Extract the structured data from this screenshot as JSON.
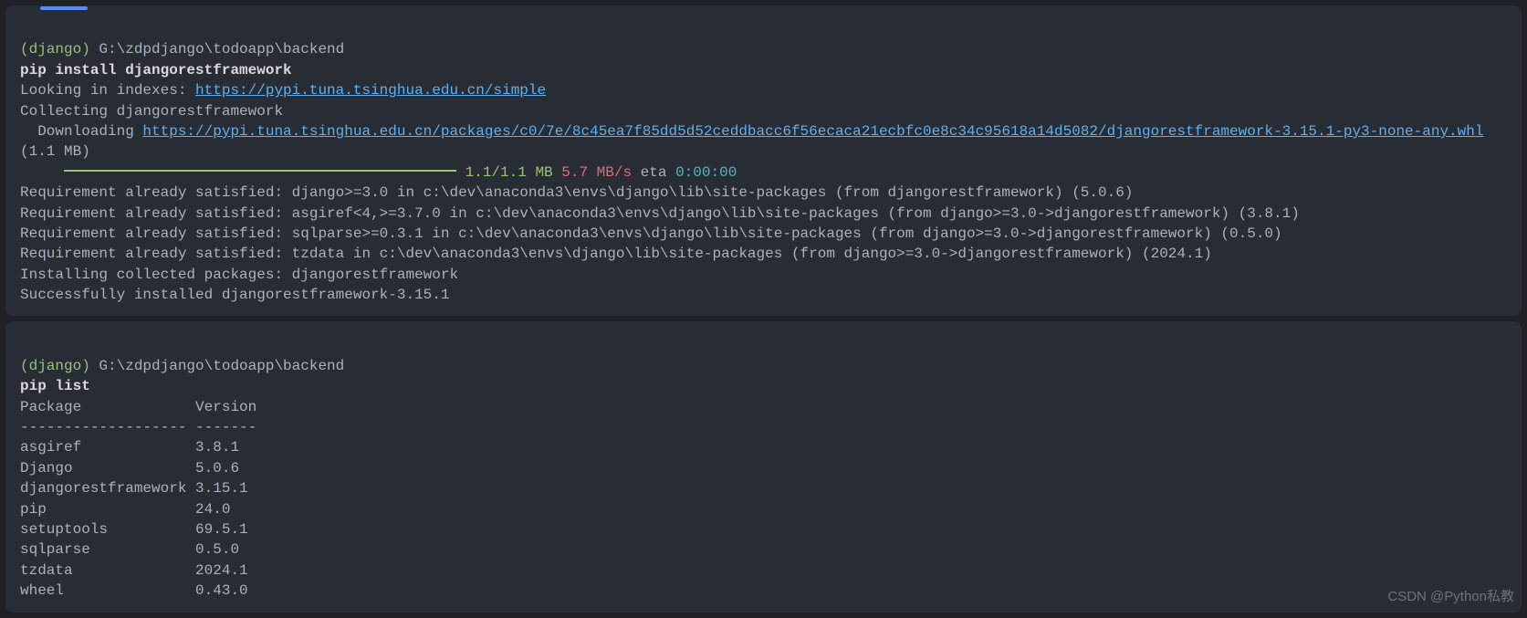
{
  "block1": {
    "prompt": {
      "env": "(django)",
      "path": " G:\\zdpdjango\\todoapp\\backend"
    },
    "command": "pip install djangorestframework",
    "lookingIn": "Looking in indexes: ",
    "indexUrl": "https://pypi.tuna.tsinghua.edu.cn/simple",
    "collecting": "Collecting djangorestframework",
    "downloading": "  Downloading ",
    "downloadUrl": "https://pypi.tuna.tsinghua.edu.cn/packages/c0/7e/8c45ea7f85dd5d52ceddbacc6f56ecaca21ecbfc0e8c34c95618a14d5082/djangorestframework-3.15.1-py3-none-any.whl",
    "downloadSize": " (1.1 MB)",
    "progress": {
      "size": "1.1/1.1 MB",
      "speed": "5.7 MB/s",
      "etaLabel": " eta ",
      "eta": "0:00:00"
    },
    "req1": "Requirement already satisfied: django>=3.0 in c:\\dev\\anaconda3\\envs\\django\\lib\\site-packages (from djangorestframework) (5.0.6)",
    "req2": "Requirement already satisfied: asgiref<4,>=3.7.0 in c:\\dev\\anaconda3\\envs\\django\\lib\\site-packages (from django>=3.0->djangorestframework) (3.8.1)",
    "req3": "Requirement already satisfied: sqlparse>=0.3.1 in c:\\dev\\anaconda3\\envs\\django\\lib\\site-packages (from django>=3.0->djangorestframework) (0.5.0)",
    "req4": "Requirement already satisfied: tzdata in c:\\dev\\anaconda3\\envs\\django\\lib\\site-packages (from django>=3.0->djangorestframework) (2024.1)",
    "installing": "Installing collected packages: djangorestframework",
    "success": "Successfully installed djangorestframework-3.15.1"
  },
  "block2": {
    "prompt": {
      "env": "(django)",
      "path": " G:\\zdpdjango\\todoapp\\backend"
    },
    "command": "pip list",
    "header": "Package             Version",
    "separator": "------------------- -------",
    "packages": [
      {
        "name": "asgiref            ",
        "version": " 3.8.1"
      },
      {
        "name": "Django             ",
        "version": " 5.0.6"
      },
      {
        "name": "djangorestframework",
        "version": " 3.15.1"
      },
      {
        "name": "pip                ",
        "version": " 24.0"
      },
      {
        "name": "setuptools         ",
        "version": " 69.5.1"
      },
      {
        "name": "sqlparse           ",
        "version": " 0.5.0"
      },
      {
        "name": "tzdata             ",
        "version": " 2024.1"
      },
      {
        "name": "wheel              ",
        "version": " 0.43.0"
      }
    ]
  },
  "watermark": "CSDN @Python私教"
}
